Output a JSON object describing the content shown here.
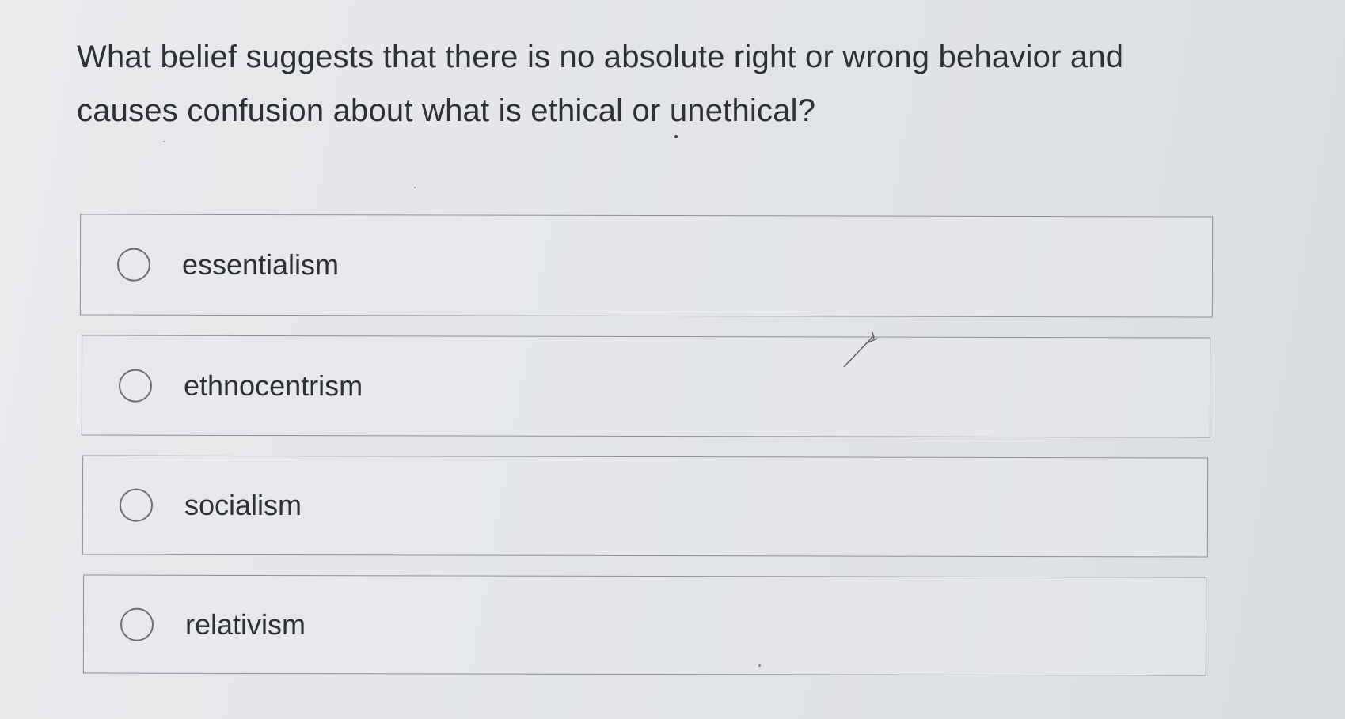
{
  "question": {
    "text": "What belief suggests that there is no absolute right or wrong behavior and causes confusion about what is ethical or unethical?"
  },
  "options": [
    {
      "label": "essentialism",
      "selected": false
    },
    {
      "label": "ethnocentrism",
      "selected": false
    },
    {
      "label": "socialism",
      "selected": false
    },
    {
      "label": "relativism",
      "selected": false
    }
  ]
}
